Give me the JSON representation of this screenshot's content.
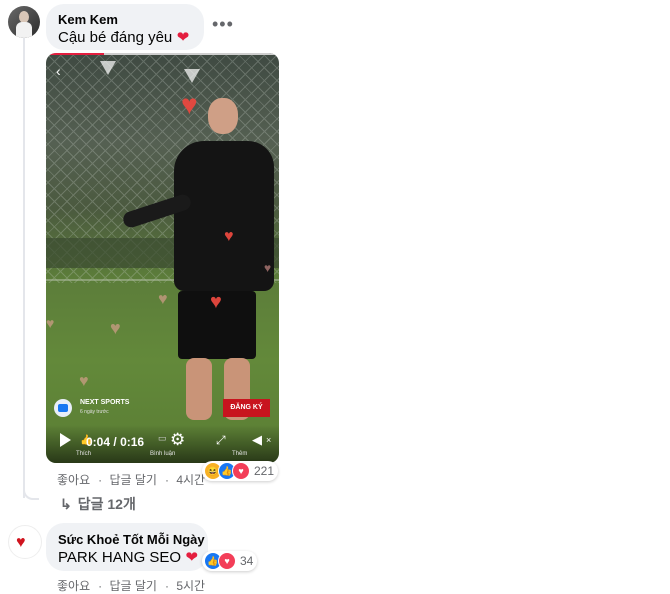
{
  "comment1": {
    "author": "Kem Kem",
    "text": "Cậu bé đáng yêu",
    "more_icon": "more-horizontal-icon",
    "actions": {
      "like": "좋아요",
      "reply": "답글 달기",
      "time": "4시간"
    },
    "reactions": {
      "icons": [
        "haha-icon",
        "like-icon",
        "love-icon"
      ],
      "count": "221"
    }
  },
  "video": {
    "channel_name": "NEXT SPORTS",
    "channel_sub": "6 ngày trước",
    "subscribe_label": "ĐĂNG KÝ",
    "current_time": "0:04",
    "separator": "/",
    "duration": "0:16",
    "progress": 0.25,
    "labels": {
      "like": "Thích",
      "comment": "Bình luận",
      "more": "Thêm"
    }
  },
  "replies": {
    "label": "답글 12개"
  },
  "comment2": {
    "author": "Sức Khoẻ Tốt Mỗi Ngày",
    "text": "PARK HANG SEO",
    "actions": {
      "like": "좋아요",
      "reply": "답글 달기",
      "time": "5시간"
    },
    "reactions": {
      "icons": [
        "like-icon",
        "love-icon"
      ],
      "count": "34"
    }
  },
  "colors": {
    "bubble": "#f0f2f5",
    "like_blue": "#1877f2",
    "love_red": "#f33e58",
    "haha_yellow": "#f7b125",
    "subscribe_red": "#c8141e"
  }
}
